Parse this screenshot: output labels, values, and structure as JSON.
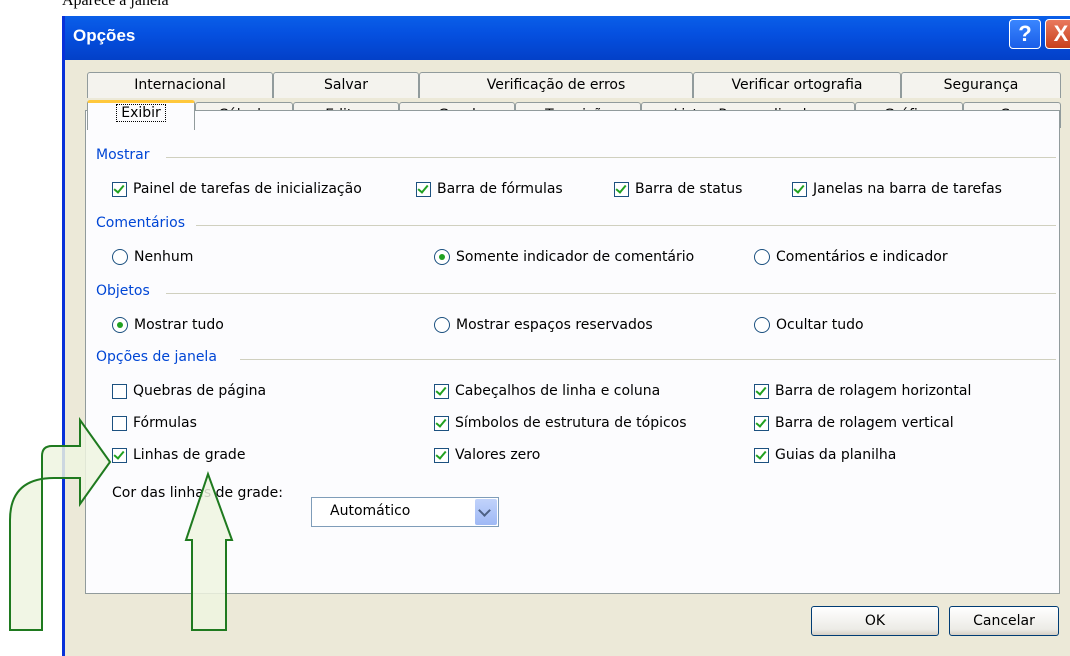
{
  "caption": "Aparece a janela",
  "window": {
    "title": "Opções",
    "help_label": "?",
    "close_label": "X"
  },
  "tabs_row1": [
    "Internacional",
    "Salvar",
    "Verificação de erros",
    "Verificar ortografia",
    "Segurança"
  ],
  "tabs_row2": [
    "Exibir",
    "Cálculo",
    "Editar",
    "Geral",
    "Transição",
    "Listas Personalizadas",
    "Gráfico",
    "Cor"
  ],
  "selected_tab": "Exibir",
  "sections": {
    "mostrar": {
      "title": "Mostrar",
      "items": [
        {
          "label": "Painel de tarefas de inicialização",
          "checked": true
        },
        {
          "label": "Barra de fórmulas",
          "checked": true
        },
        {
          "label": "Barra de status",
          "checked": true
        },
        {
          "label": "Janelas na barra de tarefas",
          "checked": true
        }
      ]
    },
    "comentarios": {
      "title": "Comentários",
      "items": [
        {
          "label": "Nenhum",
          "selected": false
        },
        {
          "label": "Somente indicador de comentário",
          "selected": true
        },
        {
          "label": "Comentários e indicador",
          "selected": false
        }
      ]
    },
    "objetos": {
      "title": "Objetos",
      "items": [
        {
          "label": "Mostrar tudo",
          "selected": true
        },
        {
          "label": "Mostrar espaços reservados",
          "selected": false
        },
        {
          "label": "Ocultar tudo",
          "selected": false
        }
      ]
    },
    "janela": {
      "title": "Opções de janela",
      "items": [
        {
          "label": "Quebras de página",
          "checked": false
        },
        {
          "label": "Cabeçalhos de linha e coluna",
          "checked": true
        },
        {
          "label": "Barra de rolagem horizontal",
          "checked": true
        },
        {
          "label": "Fórmulas",
          "checked": false
        },
        {
          "label": "Símbolos de estrutura de tópicos",
          "checked": true
        },
        {
          "label": "Barra de rolagem vertical",
          "checked": true
        },
        {
          "label": "Linhas de grade",
          "checked": true
        },
        {
          "label": "Valores zero",
          "checked": true
        },
        {
          "label": "Guias da planilha",
          "checked": true
        }
      ],
      "gridline_color_label": "Cor das linhas de grade:",
      "gridline_color_value": "Automático"
    }
  },
  "buttons": {
    "ok": "OK",
    "cancel": "Cancelar"
  },
  "colors": {
    "section_title": "#0046d5",
    "check": "#21a121",
    "annotation_arrow": "#1f7a1f"
  }
}
